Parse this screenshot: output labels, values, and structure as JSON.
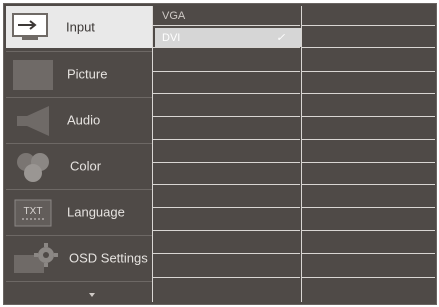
{
  "menu": {
    "items": [
      {
        "label": "Input",
        "icon": "input-icon",
        "selected": true
      },
      {
        "label": "Picture",
        "icon": "picture-icon",
        "selected": false
      },
      {
        "label": "Audio",
        "icon": "speaker-icon",
        "selected": false
      },
      {
        "label": "Color",
        "icon": "color-icon",
        "selected": false
      },
      {
        "label": "Language",
        "icon": "language-icon",
        "icon_text": "TXT",
        "selected": false
      },
      {
        "label": "OSD Settings",
        "icon": "osd-settings-icon",
        "selected": false
      }
    ],
    "more_indicator": "chevron-down-icon"
  },
  "submenu": {
    "options": [
      {
        "label": "VGA",
        "checked": false
      },
      {
        "label": "DVI",
        "checked": true
      }
    ],
    "check_mark": "✓"
  },
  "colors": {
    "background": "#4f4a47",
    "selected_bg": "#e9e9e9",
    "highlight": "#d6d6d6"
  }
}
